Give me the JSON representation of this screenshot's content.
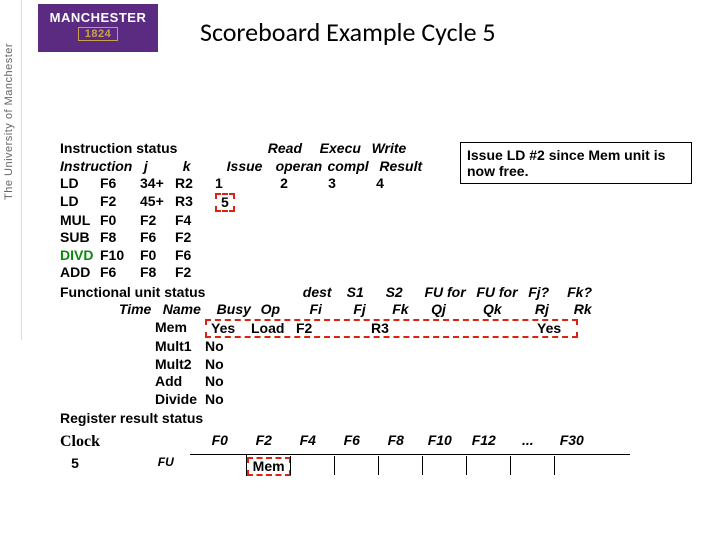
{
  "logo": {
    "name": "MANCHESTER",
    "year": "1824"
  },
  "sidebar": "The University of Manchester",
  "title": "Scoreboard Example Cycle 5",
  "callout": "Issue LD #2 since Mem unit is now free.",
  "instr_status": {
    "heading": "Instruction status",
    "cols": {
      "read": "Read",
      "exec": "Execu",
      "write": "Write"
    },
    "sub": {
      "instr": "Instruction",
      "j": "j",
      "k": "k",
      "issue": "Issue",
      "oper": "operan",
      "compl": "compl",
      "result": "Result"
    },
    "rows": [
      {
        "op": "LD",
        "dest": "F6",
        "j": "34+",
        "k": "R2",
        "issue": "1",
        "read": "2",
        "exec": "3",
        "write": "4"
      },
      {
        "op": "LD",
        "dest": "F2",
        "j": "45+",
        "k": "R3",
        "issue": "5",
        "read": "",
        "exec": "",
        "write": ""
      },
      {
        "op": "MUL",
        "dest": "F0",
        "j": "F2",
        "k": "F4",
        "issue": "",
        "read": "",
        "exec": "",
        "write": ""
      },
      {
        "op": "SUB",
        "dest": "F8",
        "j": "F6",
        "k": "F2",
        "issue": "",
        "read": "",
        "exec": "",
        "write": ""
      },
      {
        "op": "DIVD",
        "dest": "F10",
        "j": "F0",
        "k": "F6",
        "issue": "",
        "read": "",
        "exec": "",
        "write": "",
        "green": true
      },
      {
        "op": "ADD",
        "dest": "F6",
        "j": "F8",
        "k": "F2",
        "issue": "",
        "read": "",
        "exec": "",
        "write": ""
      }
    ]
  },
  "fu_status": {
    "heading": "Functional unit status",
    "cols": {
      "dest": "dest",
      "s1": "S1",
      "s2": "S2",
      "fu1": "FU for",
      "fu2": "FU for",
      "fj": "Fj?",
      "fk": "Fk?"
    },
    "sub": {
      "time": "Time",
      "name": "Name",
      "busy": "Busy",
      "op": "Op",
      "fi": "Fi",
      "fjc": "Fj",
      "fkc": "Fk",
      "qj": "Qj",
      "qk": "Qk",
      "rj": "Rj",
      "rk": "Rk"
    },
    "rows": [
      {
        "name": "Mem",
        "busy": "Yes",
        "op": "Load",
        "fi": "F2",
        "fj": "",
        "fk": "R3",
        "qj": "",
        "qk": "",
        "rj": "",
        "rk": "Yes",
        "hot": true
      },
      {
        "name": "Mult1",
        "busy": "No"
      },
      {
        "name": "Mult2",
        "busy": "No"
      },
      {
        "name": "Add",
        "busy": "No"
      },
      {
        "name": "Divide",
        "busy": "No"
      }
    ]
  },
  "reg": {
    "heading": "Register result status",
    "clock_label": "Clock",
    "clock_value": "5",
    "fu_label": "FU",
    "cols": [
      "F0",
      "F2",
      "F4",
      "F6",
      "F8",
      "F10",
      "F12",
      "...",
      "F30"
    ],
    "vals": [
      "",
      "Mem",
      "",
      "",
      "",
      "",
      "",
      "",
      ""
    ]
  }
}
